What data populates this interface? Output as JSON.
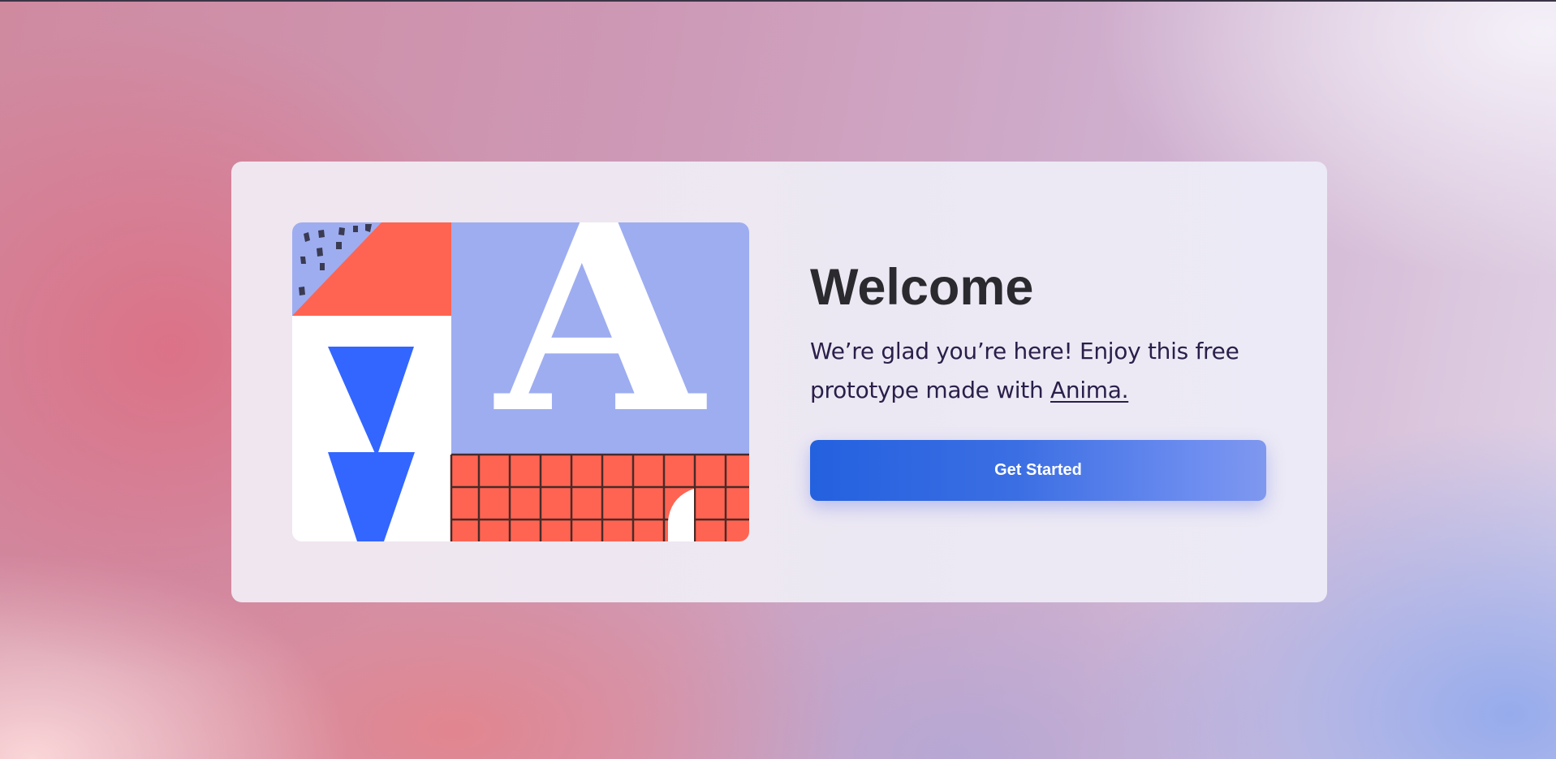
{
  "welcome": {
    "title": "Welcome",
    "subtitle_text": "We’re glad you’re here! Enjoy this free prototype made with",
    "link_label": "Anima.",
    "button_label": "Get Started"
  },
  "illustration": {
    "letter": "A",
    "colors": {
      "periwinkle": "#9eadf0",
      "coral": "#ff6452",
      "blue": "#3366ff",
      "white": "#ffffff",
      "grid_line": "#4a2a28",
      "dots": "#3a3a52"
    }
  },
  "theme": {
    "button_gradient_start": "#2461df",
    "button_gradient_end": "#7f98ef",
    "title_color": "#2b2a2e",
    "text_color": "#2a1f4a"
  }
}
